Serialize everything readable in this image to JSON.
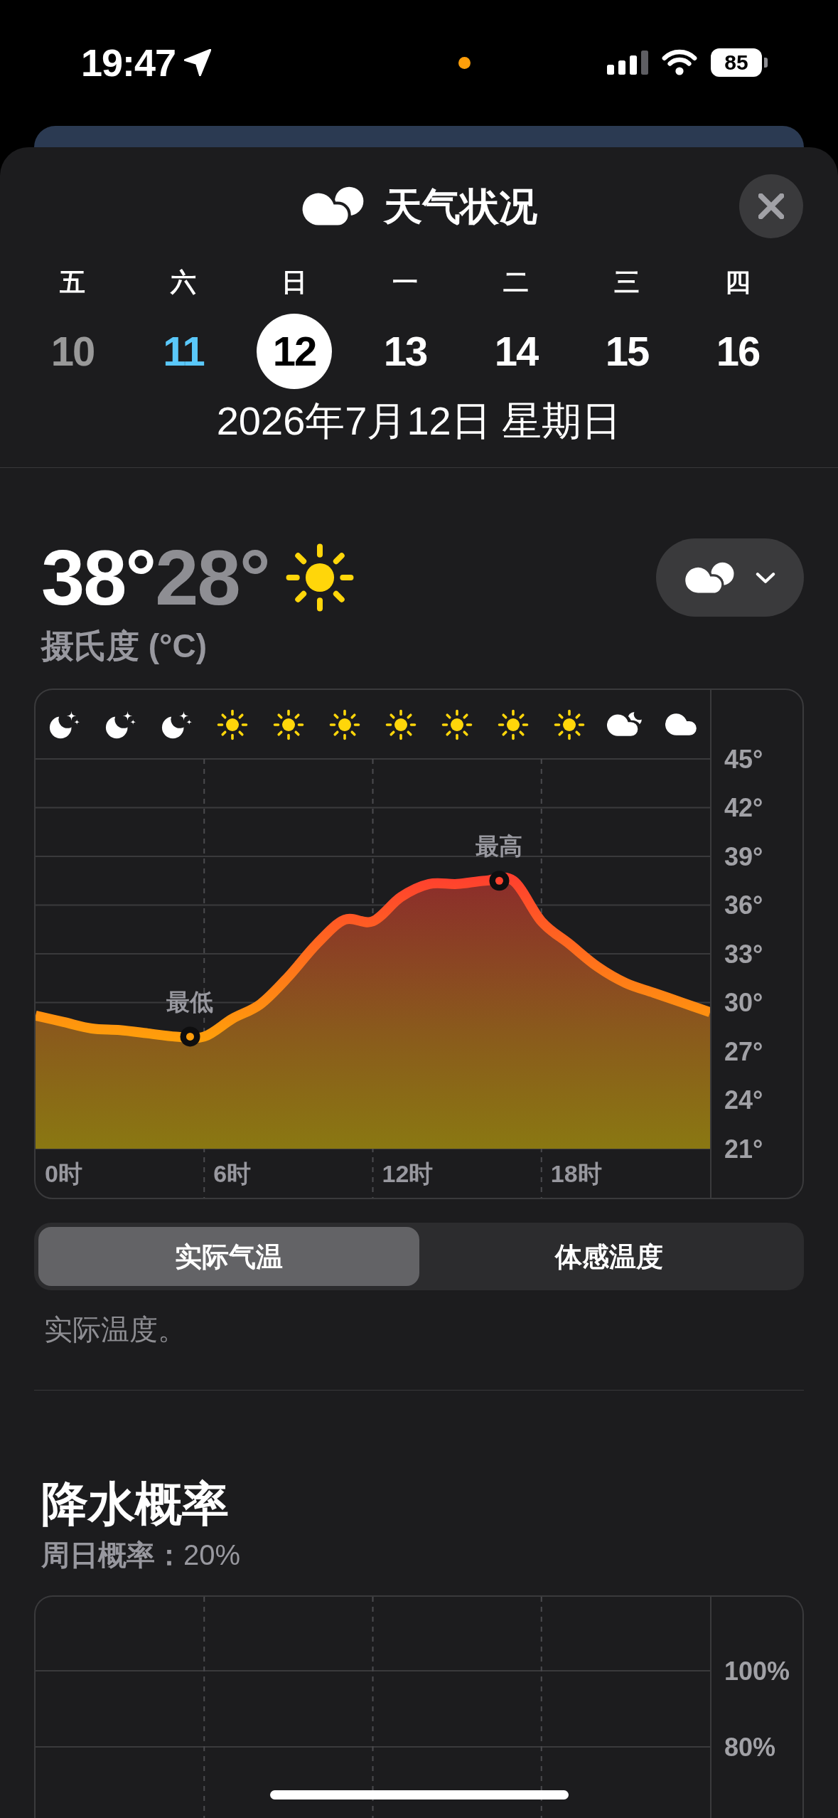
{
  "status_bar": {
    "time": "19:47",
    "battery": "85"
  },
  "header": {
    "title": "天气状况"
  },
  "days": [
    {
      "weekday": "五",
      "day": "10",
      "selected": false,
      "past": true,
      "today": false
    },
    {
      "weekday": "六",
      "day": "11",
      "selected": false,
      "past": false,
      "today": true
    },
    {
      "weekday": "日",
      "day": "12",
      "selected": true,
      "past": false,
      "today": false
    },
    {
      "weekday": "一",
      "day": "13",
      "selected": false,
      "past": false,
      "today": false
    },
    {
      "weekday": "二",
      "day": "14",
      "selected": false,
      "past": false,
      "today": false
    },
    {
      "weekday": "三",
      "day": "15",
      "selected": false,
      "past": false,
      "today": false
    },
    {
      "weekday": "四",
      "day": "16",
      "selected": false,
      "past": false,
      "today": false
    }
  ],
  "date_label": "2026年7月12日 星期日",
  "summary": {
    "high": "38°",
    "low": "28°",
    "unit": "摄氏度 (°C)"
  },
  "temperature_chart": {
    "hourly": [
      {
        "kind": "night"
      },
      {
        "kind": "night"
      },
      {
        "kind": "night"
      },
      {
        "kind": "sunny"
      },
      {
        "kind": "sunny"
      },
      {
        "kind": "sunny"
      },
      {
        "kind": "sunny"
      },
      {
        "kind": "sunny"
      },
      {
        "kind": "sunny"
      },
      {
        "kind": "sunny"
      },
      {
        "kind": "partlycloudy"
      },
      {
        "kind": "cloudy"
      }
    ],
    "time_labels": [
      "0时",
      "6时",
      "12时",
      "18时"
    ],
    "chart_data": {
      "type": "area",
      "categories": [
        null,
        null,
        null,
        null,
        null,
        null,
        null,
        null,
        null,
        null,
        null,
        null,
        null,
        null,
        null,
        null,
        null,
        null,
        null,
        null,
        null,
        null,
        null,
        null,
        null
      ],
      "values": [
        29.2,
        28.8,
        28.4,
        28.3,
        28.1,
        27.9,
        27.9,
        29.0,
        29.9,
        31.6,
        33.6,
        35.1,
        35.0,
        36.5,
        37.3,
        37.3,
        37.5,
        37.5,
        35.0,
        33.6,
        32.2,
        31.2,
        30.6,
        30.0,
        29.4
      ],
      "ylim": [
        21,
        45
      ],
      "yticks": [
        {
          "value": 45,
          "label": "45°"
        },
        {
          "value": 42,
          "label": "42°"
        },
        {
          "value": 39,
          "label": "39°"
        },
        {
          "value": 36,
          "label": "36°"
        },
        {
          "value": 33,
          "label": "33°"
        },
        {
          "value": 30,
          "label": "30°"
        },
        {
          "value": 27,
          "label": "27°"
        },
        {
          "value": 24,
          "label": "24°"
        },
        {
          "value": 21,
          "label": "21°"
        }
      ],
      "grid": true,
      "annotations": [
        "最低",
        "最高"
      ]
    }
  },
  "segments": [
    {
      "label": "实际气温",
      "selected": true
    },
    {
      "label": "体感温度",
      "selected": false
    }
  ],
  "description": "实际温度。",
  "precipitation": {
    "title": "降水概率",
    "summary": "**周日概率：**20%",
    "axis_labels": [
      "100%",
      "80%"
    ]
  }
}
